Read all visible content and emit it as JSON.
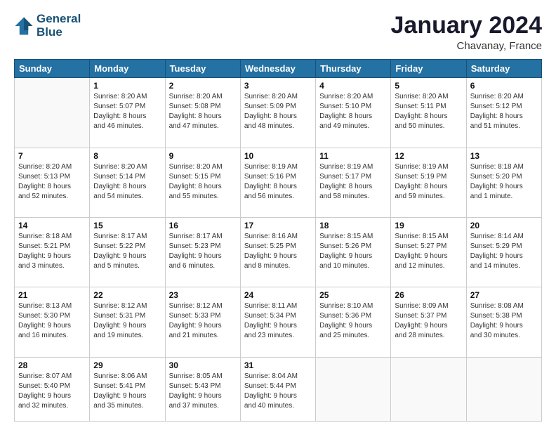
{
  "header": {
    "logo_line1": "General",
    "logo_line2": "Blue",
    "title": "January 2024",
    "subtitle": "Chavanay, France"
  },
  "columns": [
    "Sunday",
    "Monday",
    "Tuesday",
    "Wednesday",
    "Thursday",
    "Friday",
    "Saturday"
  ],
  "weeks": [
    [
      {
        "day": "",
        "info": ""
      },
      {
        "day": "1",
        "info": "Sunrise: 8:20 AM\nSunset: 5:07 PM\nDaylight: 8 hours\nand 46 minutes."
      },
      {
        "day": "2",
        "info": "Sunrise: 8:20 AM\nSunset: 5:08 PM\nDaylight: 8 hours\nand 47 minutes."
      },
      {
        "day": "3",
        "info": "Sunrise: 8:20 AM\nSunset: 5:09 PM\nDaylight: 8 hours\nand 48 minutes."
      },
      {
        "day": "4",
        "info": "Sunrise: 8:20 AM\nSunset: 5:10 PM\nDaylight: 8 hours\nand 49 minutes."
      },
      {
        "day": "5",
        "info": "Sunrise: 8:20 AM\nSunset: 5:11 PM\nDaylight: 8 hours\nand 50 minutes."
      },
      {
        "day": "6",
        "info": "Sunrise: 8:20 AM\nSunset: 5:12 PM\nDaylight: 8 hours\nand 51 minutes."
      }
    ],
    [
      {
        "day": "7",
        "info": "Sunrise: 8:20 AM\nSunset: 5:13 PM\nDaylight: 8 hours\nand 52 minutes."
      },
      {
        "day": "8",
        "info": "Sunrise: 8:20 AM\nSunset: 5:14 PM\nDaylight: 8 hours\nand 54 minutes."
      },
      {
        "day": "9",
        "info": "Sunrise: 8:20 AM\nSunset: 5:15 PM\nDaylight: 8 hours\nand 55 minutes."
      },
      {
        "day": "10",
        "info": "Sunrise: 8:19 AM\nSunset: 5:16 PM\nDaylight: 8 hours\nand 56 minutes."
      },
      {
        "day": "11",
        "info": "Sunrise: 8:19 AM\nSunset: 5:17 PM\nDaylight: 8 hours\nand 58 minutes."
      },
      {
        "day": "12",
        "info": "Sunrise: 8:19 AM\nSunset: 5:19 PM\nDaylight: 8 hours\nand 59 minutes."
      },
      {
        "day": "13",
        "info": "Sunrise: 8:18 AM\nSunset: 5:20 PM\nDaylight: 9 hours\nand 1 minute."
      }
    ],
    [
      {
        "day": "14",
        "info": "Sunrise: 8:18 AM\nSunset: 5:21 PM\nDaylight: 9 hours\nand 3 minutes."
      },
      {
        "day": "15",
        "info": "Sunrise: 8:17 AM\nSunset: 5:22 PM\nDaylight: 9 hours\nand 5 minutes."
      },
      {
        "day": "16",
        "info": "Sunrise: 8:17 AM\nSunset: 5:23 PM\nDaylight: 9 hours\nand 6 minutes."
      },
      {
        "day": "17",
        "info": "Sunrise: 8:16 AM\nSunset: 5:25 PM\nDaylight: 9 hours\nand 8 minutes."
      },
      {
        "day": "18",
        "info": "Sunrise: 8:15 AM\nSunset: 5:26 PM\nDaylight: 9 hours\nand 10 minutes."
      },
      {
        "day": "19",
        "info": "Sunrise: 8:15 AM\nSunset: 5:27 PM\nDaylight: 9 hours\nand 12 minutes."
      },
      {
        "day": "20",
        "info": "Sunrise: 8:14 AM\nSunset: 5:29 PM\nDaylight: 9 hours\nand 14 minutes."
      }
    ],
    [
      {
        "day": "21",
        "info": "Sunrise: 8:13 AM\nSunset: 5:30 PM\nDaylight: 9 hours\nand 16 minutes."
      },
      {
        "day": "22",
        "info": "Sunrise: 8:12 AM\nSunset: 5:31 PM\nDaylight: 9 hours\nand 19 minutes."
      },
      {
        "day": "23",
        "info": "Sunrise: 8:12 AM\nSunset: 5:33 PM\nDaylight: 9 hours\nand 21 minutes."
      },
      {
        "day": "24",
        "info": "Sunrise: 8:11 AM\nSunset: 5:34 PM\nDaylight: 9 hours\nand 23 minutes."
      },
      {
        "day": "25",
        "info": "Sunrise: 8:10 AM\nSunset: 5:36 PM\nDaylight: 9 hours\nand 25 minutes."
      },
      {
        "day": "26",
        "info": "Sunrise: 8:09 AM\nSunset: 5:37 PM\nDaylight: 9 hours\nand 28 minutes."
      },
      {
        "day": "27",
        "info": "Sunrise: 8:08 AM\nSunset: 5:38 PM\nDaylight: 9 hours\nand 30 minutes."
      }
    ],
    [
      {
        "day": "28",
        "info": "Sunrise: 8:07 AM\nSunset: 5:40 PM\nDaylight: 9 hours\nand 32 minutes."
      },
      {
        "day": "29",
        "info": "Sunrise: 8:06 AM\nSunset: 5:41 PM\nDaylight: 9 hours\nand 35 minutes."
      },
      {
        "day": "30",
        "info": "Sunrise: 8:05 AM\nSunset: 5:43 PM\nDaylight: 9 hours\nand 37 minutes."
      },
      {
        "day": "31",
        "info": "Sunrise: 8:04 AM\nSunset: 5:44 PM\nDaylight: 9 hours\nand 40 minutes."
      },
      {
        "day": "",
        "info": ""
      },
      {
        "day": "",
        "info": ""
      },
      {
        "day": "",
        "info": ""
      }
    ]
  ]
}
